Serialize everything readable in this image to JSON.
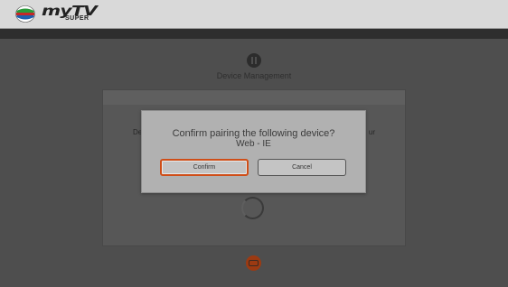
{
  "header": {
    "brand_name": "myTV",
    "brand_sub": "SUPER"
  },
  "page": {
    "title": "Device Management",
    "left_fragment": "De",
    "right_fragment": "ur"
  },
  "dialog": {
    "title": "Confirm pairing the following device?",
    "device": "Web - IE",
    "confirm_label": "Confirm",
    "cancel_label": "Cancel"
  },
  "colors": {
    "accent": "#cf4e18",
    "back_button": "#9c3a12"
  },
  "icons": [
    "tvb-logo-icon",
    "device-management-icon",
    "loading-spinner-icon",
    "back-icon"
  ]
}
